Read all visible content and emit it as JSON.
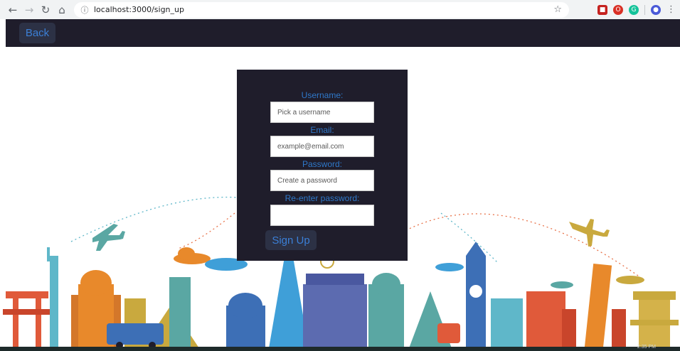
{
  "browser": {
    "url": "localhost:3000/sign_up",
    "icons": [
      "back-arrow-icon",
      "forward-arrow-icon",
      "reload-icon",
      "home-icon",
      "info-icon",
      "star-icon"
    ]
  },
  "navbar": {
    "back_label": "Back"
  },
  "form": {
    "username_label": "Username:",
    "username_placeholder": "Pick a username",
    "email_label": "Email:",
    "email_placeholder": "example@email.com",
    "password_label": "Password:",
    "password_placeholder": "Create a password",
    "reenter_label": "Re-enter password:",
    "reenter_placeholder": "",
    "submit_label": "Sign Up"
  },
  "colors": {
    "navbar_bg": "#1f1d2b",
    "card_bg": "#1f1d2b",
    "accent_text": "#2f78c9",
    "button_bg": "#2c3145"
  },
  "taskbar": {
    "time": "2:35 PM"
  }
}
